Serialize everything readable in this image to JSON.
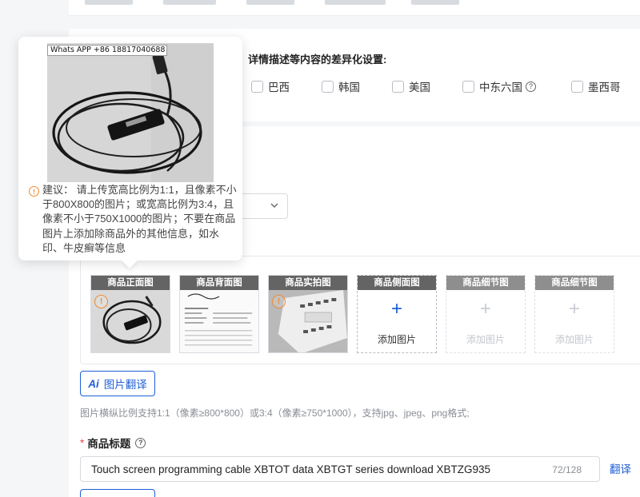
{
  "country_settings": {
    "title": "详情描述等内容的差异化设置:",
    "countries": [
      {
        "label": "巴西",
        "checked": false
      },
      {
        "label": "韩国",
        "checked": false
      },
      {
        "label": "美国",
        "checked": false
      },
      {
        "label": "中东六国",
        "checked": false,
        "help": true
      },
      {
        "label": "墨西哥",
        "checked": false
      }
    ]
  },
  "images": {
    "slots": [
      {
        "label": "商品正面图",
        "state": "filled",
        "warning": true
      },
      {
        "label": "商品背面图",
        "state": "filled",
        "warning": false
      },
      {
        "label": "商品实拍图",
        "state": "filled",
        "warning": true
      },
      {
        "label": "商品侧面图",
        "state": "empty",
        "add_label": "添加图片"
      },
      {
        "label": "商品细节图",
        "state": "disabled",
        "add_label": "添加图片"
      },
      {
        "label": "商品细节图",
        "state": "disabled",
        "add_label": "添加图片"
      }
    ],
    "translate_button": "图片翻译",
    "translate_icon": "Ai",
    "hint": "图片横纵比例支持1:1（像素≥800*800）或3:4（像素≥750*1000），支持jpg、jpeg、png格式;"
  },
  "product_title": {
    "label": "商品标题",
    "required_mark": "*",
    "value": "Touch screen programming cable XBTOT data XBTGT series download XBTZG935",
    "count": "72/128",
    "translate_link": "翻译"
  },
  "tooltip": {
    "watermark": "Whats APP +86 18817040688",
    "advice": "建议： 请上传宽高比例为1:1，且像素不小于800X800的图片；或宽高比例为3:4，且像素不小于750X1000的图片；不要在商品图片上添加除商品外的其他信息，如水印、牛皮癣等信息"
  },
  "colors": {
    "accent": "#1e5fd8",
    "warning": "#f08a2c",
    "slot_label_bg": "#646464"
  }
}
